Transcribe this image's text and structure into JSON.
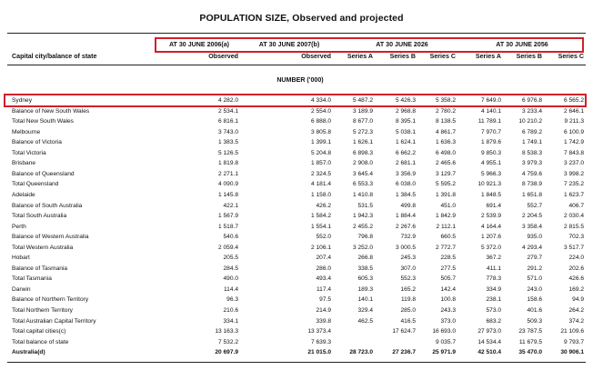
{
  "title": "POPULATION SIZE, Observed and projected",
  "headers": {
    "period_2006": "AT 30 JUNE 2006(a)",
    "period_2007": "AT 30 JUNE 2007(b)",
    "period_2026": "AT 30 JUNE 2026",
    "period_2056": "AT 30 JUNE 2056",
    "row_label": "Capital city/balance of state",
    "columns": [
      "Observed",
      "Observed",
      "Series A",
      "Series B",
      "Series C",
      "Series A",
      "Series B",
      "Series C"
    ],
    "unit": "NUMBER ('000)"
  },
  "table": {
    "rows": [
      {
        "label": "Sydney",
        "values": [
          "4 282.0",
          "4 334.0",
          "5 487.2",
          "5 426.3",
          "5 358.2",
          "7 649.0",
          "6 976.8",
          "6 565.2"
        ],
        "bold": false
      },
      {
        "label": "Balance of New South Wales",
        "values": [
          "2 534.1",
          "2 554.0",
          "3 189.9",
          "2 968.8",
          "2 780.2",
          "4 140.1",
          "3 233.4",
          "2 646.1"
        ],
        "bold": false
      },
      {
        "label": "Total New South Wales",
        "values": [
          "6 816.1",
          "6 888.0",
          "8 677.0",
          "8 395.1",
          "8 138.5",
          "11 789.1",
          "10 210.2",
          "9 211.3"
        ],
        "bold": false
      },
      {
        "label": "Melbourne",
        "values": [
          "3 743.0",
          "3 805.8",
          "5 272.3",
          "5 038.1",
          "4 861.7",
          "7 970.7",
          "6 789.2",
          "6 100.9"
        ],
        "bold": false
      },
      {
        "label": "Balance of Victoria",
        "values": [
          "1 383.5",
          "1 399.1",
          "1 626.1",
          "1 624.1",
          "1 636.3",
          "1 879.6",
          "1 749.1",
          "1 742.9"
        ],
        "bold": false
      },
      {
        "label": "Total Victoria",
        "values": [
          "5 126.5",
          "5 204.8",
          "6 898.3",
          "6 662.2",
          "6 498.0",
          "9 850.3",
          "8 538.3",
          "7 843.8"
        ],
        "bold": false
      },
      {
        "label": "Brisbane",
        "values": [
          "1 819.8",
          "1 857.0",
          "2 908.0",
          "2 681.1",
          "2 465.6",
          "4 955.1",
          "3 979.3",
          "3 237.0"
        ],
        "bold": false
      },
      {
        "label": "Balance of Queensland",
        "values": [
          "2 271.1",
          "2 324.5",
          "3 645.4",
          "3 356.9",
          "3 129.7",
          "5 966.3",
          "4 759.6",
          "3 998.2"
        ],
        "bold": false
      },
      {
        "label": "Total Queensland",
        "values": [
          "4 090.9",
          "4 181.4",
          "6 553.3",
          "6 038.0",
          "5 595.2",
          "10 921.3",
          "8 738.9",
          "7 235.2"
        ],
        "bold": false
      },
      {
        "label": "Adelaide",
        "values": [
          "1 145.8",
          "1 158.0",
          "1 410.8",
          "1 384.5",
          "1 391.8",
          "1 848.5",
          "1 651.8",
          "1 623.7"
        ],
        "bold": false
      },
      {
        "label": "Balance of South Australia",
        "values": [
          "422.1",
          "426.2",
          "531.5",
          "499.8",
          "451.0",
          "691.4",
          "552.7",
          "406.7"
        ],
        "bold": false
      },
      {
        "label": "Total South Australia",
        "values": [
          "1 567.9",
          "1 584.2",
          "1 942.3",
          "1 884.4",
          "1 842.9",
          "2 539.9",
          "2 204.5",
          "2 030.4"
        ],
        "bold": false
      },
      {
        "label": "Perth",
        "values": [
          "1 518.7",
          "1 554.1",
          "2 455.2",
          "2 267.6",
          "2 112.1",
          "4 164.4",
          "3 358.4",
          "2 815.5"
        ],
        "bold": false
      },
      {
        "label": "Balance of Western Australia",
        "values": [
          "540.6",
          "552.0",
          "796.8",
          "732.9",
          "660.5",
          "1 207.6",
          "935.0",
          "702.3"
        ],
        "bold": false
      },
      {
        "label": "Total Western Australia",
        "values": [
          "2 059.4",
          "2 106.1",
          "3 252.0",
          "3 000.5",
          "2 772.7",
          "5 372.0",
          "4 293.4",
          "3 517.7"
        ],
        "bold": false
      },
      {
        "label": "Hobart",
        "values": [
          "205.5",
          "207.4",
          "266.8",
          "245.3",
          "228.5",
          "367.2",
          "279.7",
          "224.0"
        ],
        "bold": false
      },
      {
        "label": "Balance of Tasmania",
        "values": [
          "284.5",
          "286.0",
          "338.5",
          "307.0",
          "277.5",
          "411.1",
          "291.2",
          "202.6"
        ],
        "bold": false
      },
      {
        "label": "Total Tasmania",
        "values": [
          "490.0",
          "493.4",
          "605.3",
          "552.3",
          "505.7",
          "778.3",
          "571.0",
          "426.6"
        ],
        "bold": false
      },
      {
        "label": "Darwin",
        "values": [
          "114.4",
          "117.4",
          "189.3",
          "165.2",
          "142.4",
          "334.9",
          "243.0",
          "169.2"
        ],
        "bold": false
      },
      {
        "label": "Balance of Northern Territory",
        "values": [
          "96.3",
          "97.5",
          "140.1",
          "119.8",
          "100.8",
          "238.1",
          "158.6",
          "94.9"
        ],
        "bold": false
      },
      {
        "label": "Total Northern Territory",
        "values": [
          "210.6",
          "214.9",
          "329.4",
          "285.0",
          "243.3",
          "573.0",
          "401.6",
          "264.2"
        ],
        "bold": false
      },
      {
        "label": "Total Australian Capital Territory",
        "values": [
          "334.1",
          "339.8",
          "462.5",
          "416.5",
          "373.0",
          "683.2",
          "509.3",
          "374.2"
        ],
        "bold": false
      },
      {
        "label": "Total capital cities(c)",
        "values": [
          "13 163.3",
          "13 373.4",
          "",
          "17 624.7",
          "16 693.0",
          "27 973.0",
          "23 787.5",
          "21 109.6"
        ],
        "bold": false
      },
      {
        "label": "Total balance of state",
        "values": [
          "7 532.2",
          "7 639.3",
          "",
          "",
          "9 035.7",
          "14 534.4",
          "11 679.5",
          "9 793.7"
        ],
        "bold": false
      },
      {
        "label": "Australia(d)",
        "values": [
          "20 697.9",
          "21 015.0",
          "28 723.0",
          "27 236.7",
          "25 971.9",
          "42 510.4",
          "35 470.0",
          "30 906.1"
        ],
        "bold": true
      }
    ]
  }
}
